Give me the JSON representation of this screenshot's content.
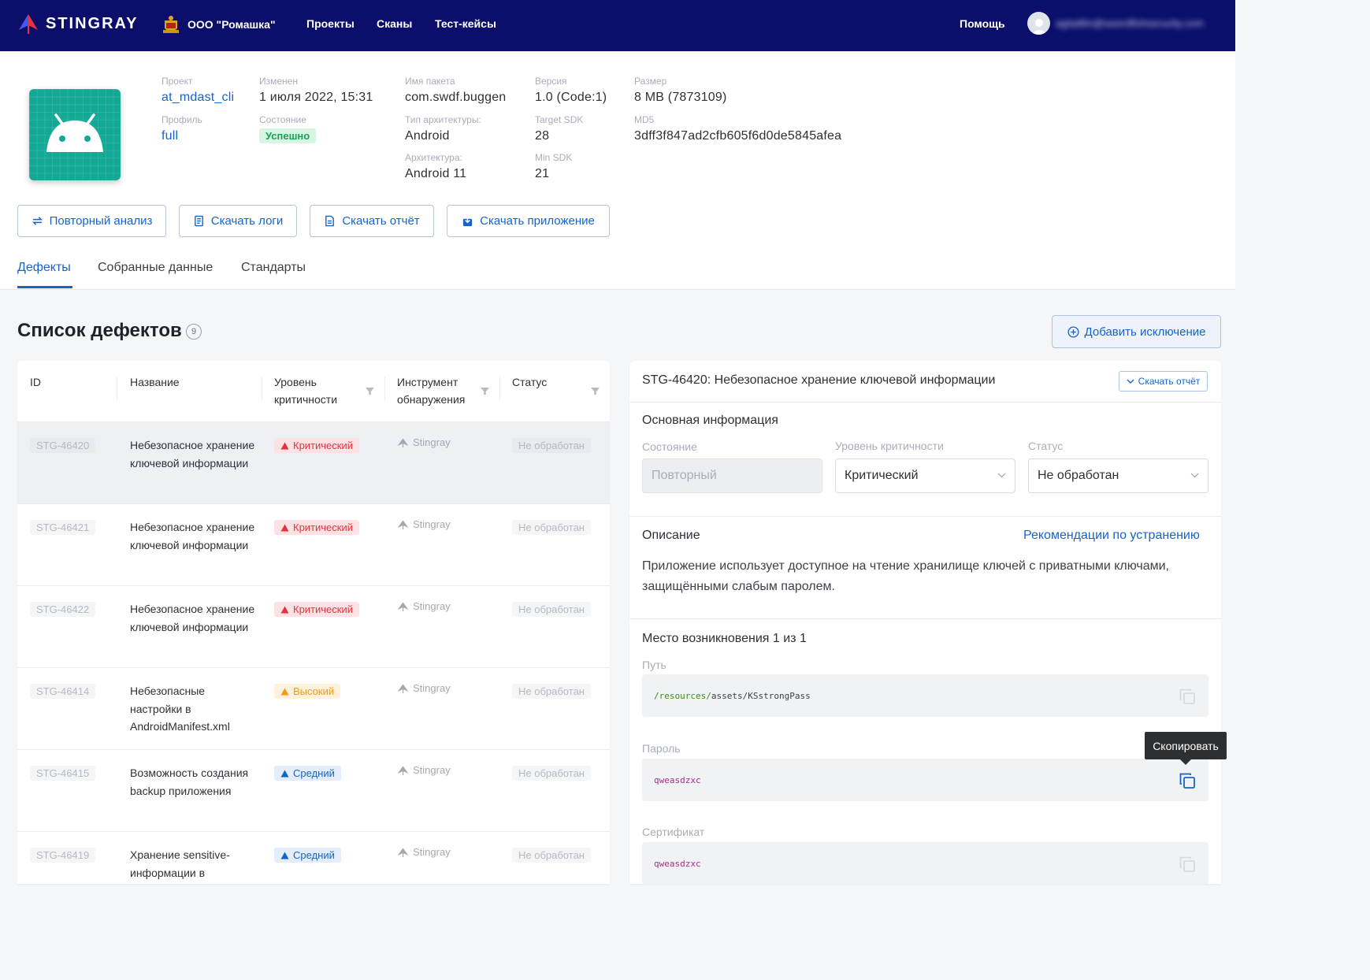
{
  "nav": {
    "brand": "STINGRAY",
    "org": "ООО \"Ромашка\"",
    "links": [
      "Проекты",
      "Сканы",
      "Тест-кейсы"
    ],
    "help": "Помощь",
    "user_email": "agladilin@swordfishsecurity.com"
  },
  "app": {
    "project_label": "Проект",
    "project_value": "at_mdast_cli",
    "profile_label": "Профиль",
    "profile_value": "full",
    "modified_label": "Изменен",
    "modified_value": "1 июля 2022, 15:31",
    "state_label": "Состояние",
    "state_value": "Успешно",
    "package_label": "Имя пакета",
    "package_value": "com.swdf.buggen",
    "arch_type_label": "Тип архитектуры:",
    "arch_type_value": "Android",
    "arch_label": "Архитектура:",
    "arch_value": "Android 11",
    "version_label": "Версия",
    "version_value": "1.0 (Code:1)",
    "target_sdk_label": "Target SDK",
    "target_sdk_value": "28",
    "min_sdk_label": "Min SDK",
    "min_sdk_value": "21",
    "size_label": "Размер",
    "size_value": "8 MB (7873109)",
    "md5_label": "MD5",
    "md5_value": "3dff3f847ad2cfb605f6d0de5845afea"
  },
  "actions": {
    "reanalyze": "Повторный анализ",
    "download_logs": "Скачать логи",
    "download_report": "Скачать отчёт",
    "download_app": "Скачать приложение"
  },
  "tabs": [
    "Дефекты",
    "Собранные данные",
    "Стандарты"
  ],
  "defects": {
    "title": "Список дефектов",
    "count": "9",
    "add_exception": "Добавить исключение",
    "columns": {
      "id": "ID",
      "name": "Название",
      "severity_1": "Уровень",
      "severity_2": "критичности",
      "tool_1": "Инструмент",
      "tool_2": "обнаружения",
      "status": "Статус"
    },
    "rows": [
      {
        "id": "STG-46420",
        "name": "Небезопасное хранение ключевой информации",
        "severity": "Критический",
        "sev_class": "crit",
        "tool": "Stingray",
        "status": "Не обработан"
      },
      {
        "id": "STG-46421",
        "name": "Небезопасное хранение ключевой информации",
        "severity": "Критический",
        "sev_class": "crit",
        "tool": "Stingray",
        "status": "Не обработан"
      },
      {
        "id": "STG-46422",
        "name": "Небезопасное хранение ключевой информации",
        "severity": "Критический",
        "sev_class": "crit",
        "tool": "Stingray",
        "status": "Не обработан"
      },
      {
        "id": "STG-46414",
        "name": "Небезопасные настройки в AndroidManifest.xml",
        "severity": "Высокий",
        "sev_class": "high",
        "tool": "Stingray",
        "status": "Не обработан"
      },
      {
        "id": "STG-46415",
        "name": "Возможность создания backup приложения",
        "severity": "Средний",
        "sev_class": "mid",
        "tool": "Stingray",
        "status": "Не обработан"
      },
      {
        "id": "STG-46419",
        "name": "Хранение sensitive-информации в",
        "severity": "Средний",
        "sev_class": "mid",
        "tool": "Stingray",
        "status": "Не обработан"
      }
    ]
  },
  "detail": {
    "title": "STG-46420: Небезопасное хранение ключевой информации",
    "download_report": "Скачать отчёт",
    "main_info": "Основная информация",
    "state_label": "Состояние",
    "state_value": "Повторный",
    "severity_label": "Уровень критичности",
    "severity_value": "Критический",
    "status_label": "Статус",
    "status_value": "Не обработан",
    "description_title": "Описание",
    "recommendations": "Рекомендации по устранению",
    "description": "Приложение использует доступное на чтение хранилище ключей с приватными ключами, защищёнными слабым паролем.",
    "location_title": "Место возникновения 1 из 1",
    "path_label": "Путь",
    "path_prefix": "/resources/",
    "path_rest": "assets/KSstrongPass",
    "password_label": "Пароль",
    "password_value": "qweasdzxc",
    "cert_label": "Сертификат",
    "cert_value": "qweasdzxc",
    "copy_tooltip": "Скопировать"
  },
  "colors": {
    "nav_bg": "#0b0f6b",
    "accent": "#1664c9",
    "critical": "#e2323e",
    "high": "#f09b16",
    "success": "#13a355",
    "app_icon_bg": "#14a996"
  }
}
